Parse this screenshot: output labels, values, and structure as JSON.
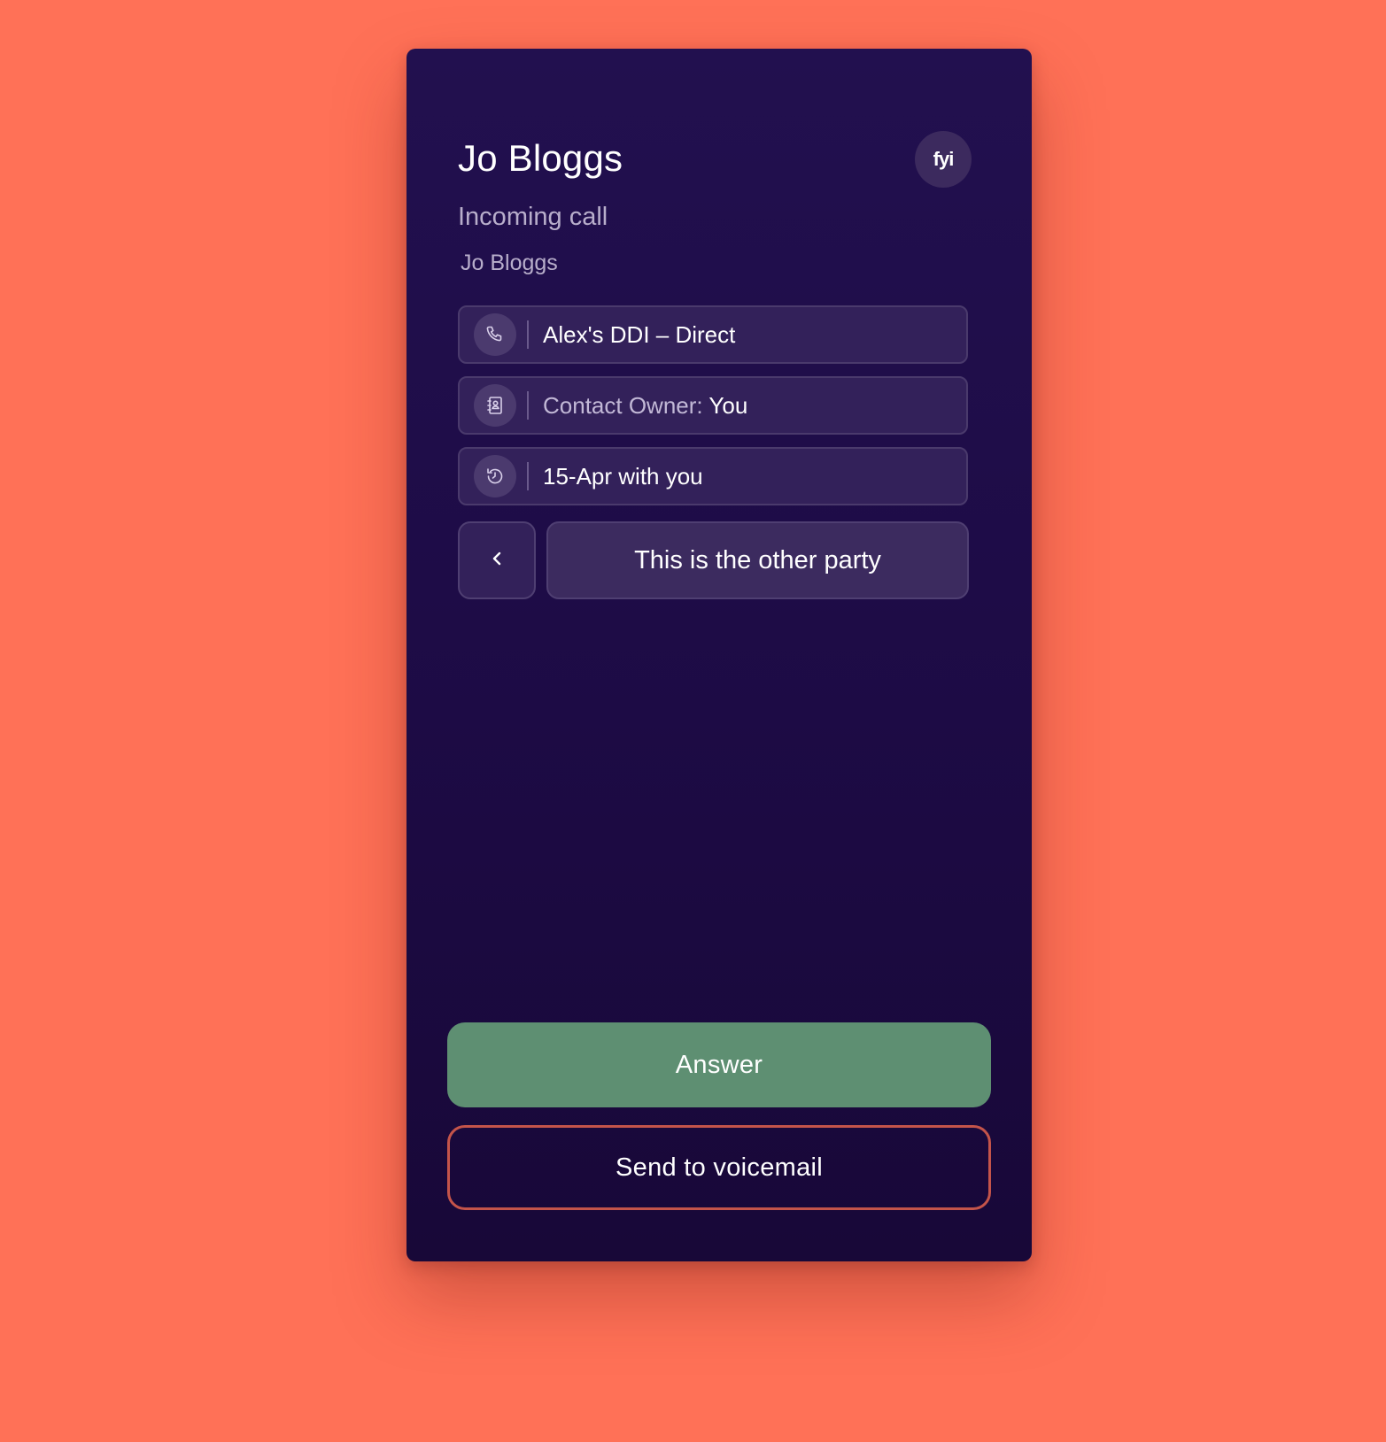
{
  "caller": {
    "name": "Jo Bloggs",
    "status": "Incoming call",
    "contact_name": "Jo Bloggs",
    "fyi_label": "fyi"
  },
  "details": {
    "line": {
      "icon": "phone-icon",
      "text": "Alex's DDI – Direct"
    },
    "owner": {
      "icon": "contact-book-icon",
      "label": "Contact Owner:",
      "value": "You"
    },
    "history": {
      "icon": "history-icon",
      "text": "15-Apr with you"
    }
  },
  "party": {
    "back_icon": "chevron-left-icon",
    "label": "This is the other party"
  },
  "actions": {
    "answer_label": "Answer",
    "voicemail_label": "Send to voicemail"
  },
  "colors": {
    "background": "#ff7157",
    "panel": "#1d0b45",
    "answer": "#5e8f72",
    "voicemail_border": "#c4544a"
  }
}
